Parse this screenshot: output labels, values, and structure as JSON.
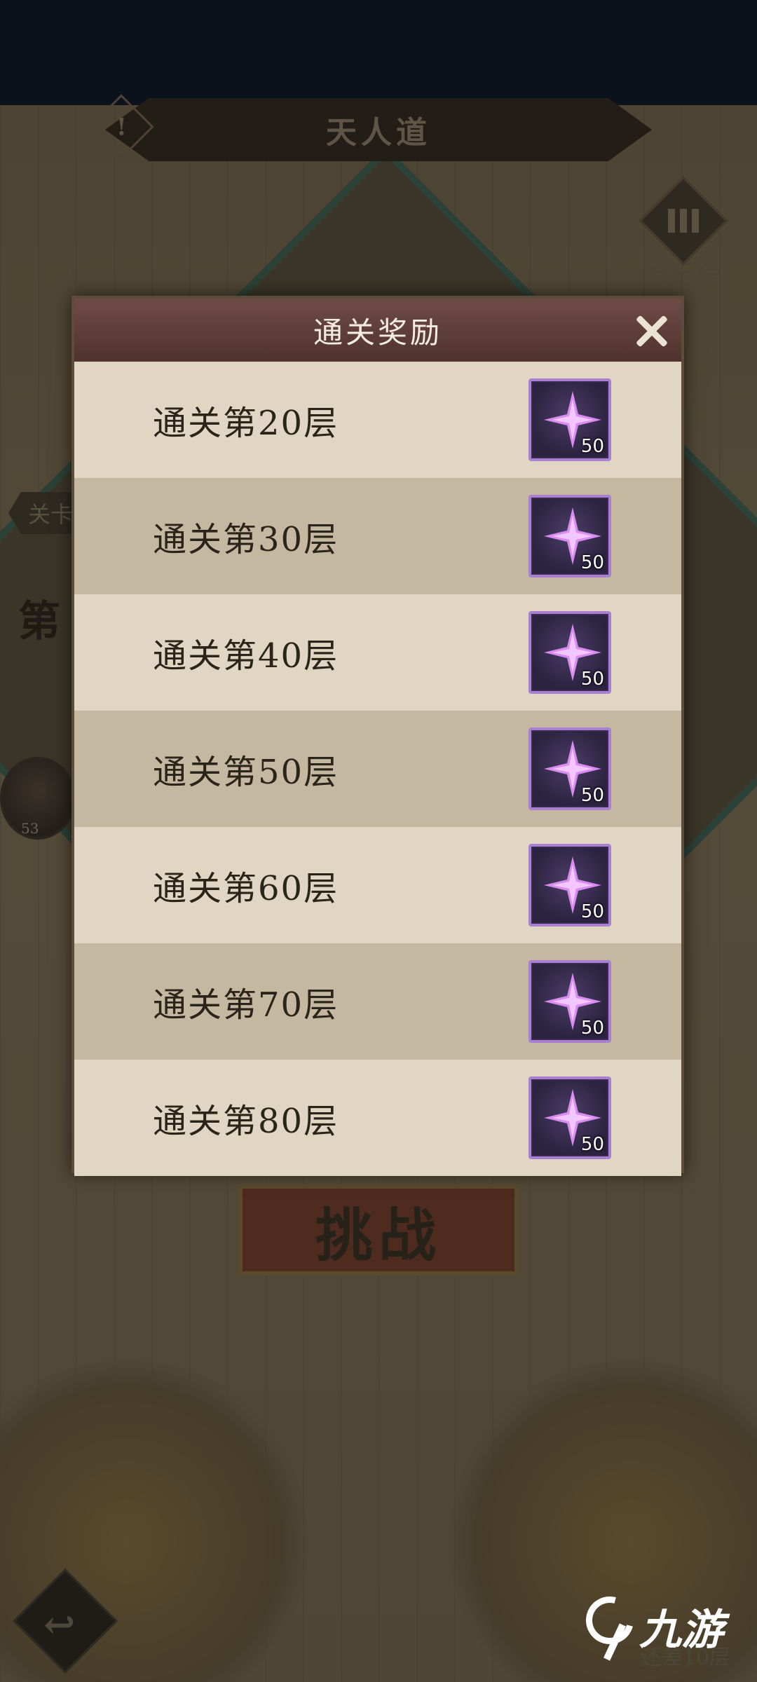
{
  "background": {
    "title": "天人道",
    "rank_label": "排行榜",
    "stage_tab": "关卡",
    "stage_heading": "第",
    "avatar_level": "53",
    "challenge_label": "挑战",
    "remaining_text": "还差10层",
    "watermark": "九游"
  },
  "modal": {
    "title": "通关奖励",
    "rewards": [
      {
        "label": "通关第20层",
        "item_icon": "purple-star-shard-icon",
        "quantity": "50"
      },
      {
        "label": "通关第30层",
        "item_icon": "purple-star-shard-icon",
        "quantity": "50"
      },
      {
        "label": "通关第40层",
        "item_icon": "purple-star-shard-icon",
        "quantity": "50"
      },
      {
        "label": "通关第50层",
        "item_icon": "purple-star-shard-icon",
        "quantity": "50"
      },
      {
        "label": "通关第60层",
        "item_icon": "purple-star-shard-icon",
        "quantity": "50"
      },
      {
        "label": "通关第70层",
        "item_icon": "purple-star-shard-icon",
        "quantity": "50"
      },
      {
        "label": "通关第80层",
        "item_icon": "purple-star-shard-icon",
        "quantity": "50"
      }
    ]
  },
  "colors": {
    "header": "#5e3d39",
    "row_light": "#e0d6c3",
    "row_dark": "#c5b8a1",
    "item_border": "#a97fd1",
    "item_star": "#d98cf0"
  }
}
